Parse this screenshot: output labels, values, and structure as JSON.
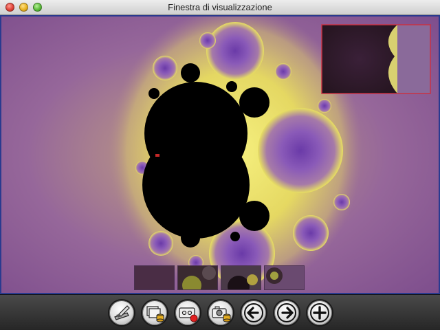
{
  "window": {
    "title": "Finestra di visualizzazione"
  },
  "toolbar": {
    "buttons": [
      {
        "name": "edit-palette-button",
        "icon": "brush-palette-icon"
      },
      {
        "name": "save-view-button",
        "icon": "windows-database-icon"
      },
      {
        "name": "record-button",
        "icon": "tape-record-icon"
      },
      {
        "name": "camera-save-button",
        "icon": "camera-database-icon"
      },
      {
        "name": "back-button",
        "icon": "arrow-left-icon"
      },
      {
        "name": "forward-button",
        "icon": "arrow-right-icon"
      },
      {
        "name": "zoom-in-button",
        "icon": "plus-icon"
      }
    ]
  },
  "colors": {
    "background_outer": "#7e4f8e",
    "background_inner": "#b08a8a",
    "fractal_body": "#000000",
    "fractal_edge": "#ffff66",
    "frame_border": "#2a3a8f",
    "preview_border": "#c83244"
  }
}
